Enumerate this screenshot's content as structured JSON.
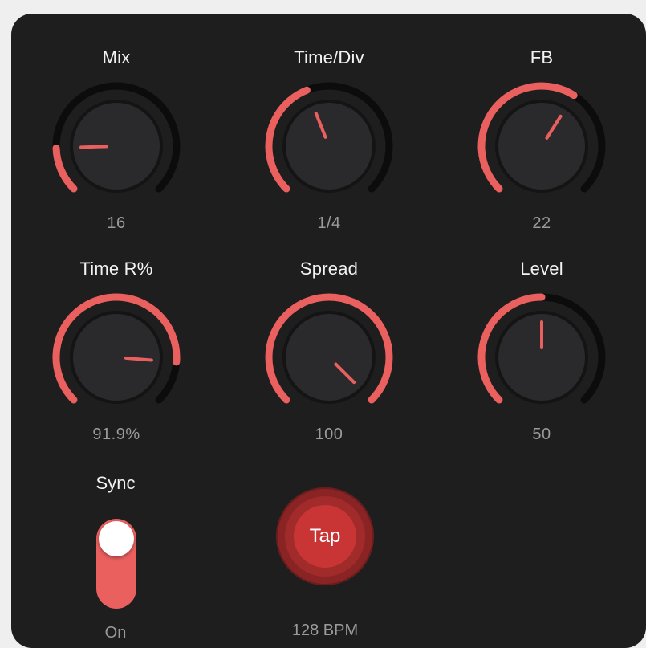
{
  "colors": {
    "accent": "#e9605f",
    "knob_body": "#2a2a2c",
    "track": "#0c0c0d",
    "panel": "#1e1e1f",
    "label": "#f2f2f2",
    "value": "#9b9b9e"
  },
  "knobs": [
    {
      "label": "Mix",
      "value": "16",
      "level": 0.16
    },
    {
      "label": "Time/Div",
      "value": "1/4",
      "level": 0.42
    },
    {
      "label": "FB",
      "value": "22",
      "level": 0.62
    },
    {
      "label": "Time R%",
      "value": "91.9%",
      "level": 0.85
    },
    {
      "label": "Spread",
      "value": "100",
      "level": 1.0
    },
    {
      "label": "Level",
      "value": "50",
      "level": 0.5
    }
  ],
  "sync": {
    "label": "Sync",
    "value": "On",
    "on": true
  },
  "tap": {
    "label": "Tap",
    "bpm": "128 BPM"
  }
}
